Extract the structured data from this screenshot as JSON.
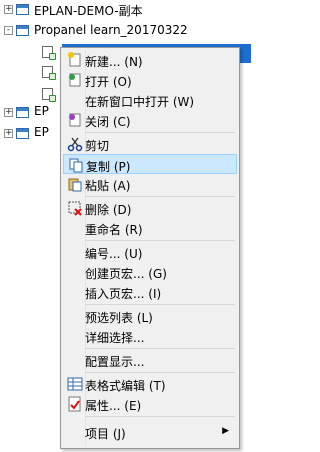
{
  "tree": {
    "items": [
      {
        "label": "EPLAN-DEMO-副本",
        "expander": "+"
      },
      {
        "label": "Propanel learn_20170322",
        "expander": "-"
      },
      {
        "label": "",
        "expander": ""
      },
      {
        "label": "",
        "expander": ""
      },
      {
        "label": "",
        "expander": ""
      },
      {
        "label": "EP",
        "expander": "+"
      },
      {
        "label": "EP",
        "expander": "+"
      }
    ]
  },
  "menu": {
    "items": [
      {
        "label": "新建... (N)",
        "icon": "new-icon"
      },
      {
        "label": "打开 (O)",
        "icon": "open-icon"
      },
      {
        "label": "在新窗口中打开 (W)",
        "icon": ""
      },
      {
        "label": "关闭 (C)",
        "icon": "close-icon"
      },
      {
        "label": "剪切",
        "icon": "scissors-icon"
      },
      {
        "label": "复制 (P)",
        "icon": "copy-icon"
      },
      {
        "label": "粘贴 (A)",
        "icon": "paste-icon"
      },
      {
        "label": "删除 (D)",
        "icon": "delete-icon"
      },
      {
        "label": "重命名 (R)",
        "icon": ""
      },
      {
        "label": "编号... (U)",
        "icon": ""
      },
      {
        "label": "创建页宏... (G)",
        "icon": ""
      },
      {
        "label": "插入页宏... (I)",
        "icon": ""
      },
      {
        "label": "预选列表 (L)",
        "icon": ""
      },
      {
        "label": "详细选择...",
        "icon": ""
      },
      {
        "label": "配置显示...",
        "icon": ""
      },
      {
        "label": "表格式编辑 (T)",
        "icon": "table-icon"
      },
      {
        "label": "属性... (E)",
        "icon": "properties-icon"
      },
      {
        "label": "项目 (J)",
        "icon": "",
        "submenu": true
      }
    ],
    "highlighted": "复制 (P)"
  },
  "colors": {
    "selection": "#1c6fd1",
    "hover": "#cce8ff",
    "menu_bg": "#f0f0f0"
  }
}
